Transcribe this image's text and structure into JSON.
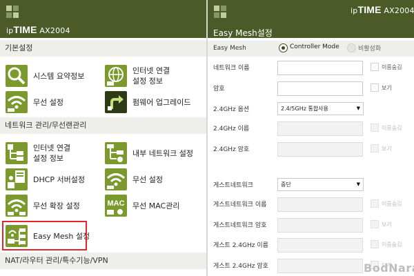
{
  "left": {
    "brand": {
      "prefix": "ip",
      "name": "TIME",
      "model": "AX2004"
    },
    "sections": {
      "basic": "기본설정",
      "network": "네트워크 관리/무선랜관리",
      "nat": "NAT/라우터 관리/특수기능/VPN"
    },
    "basic_items": [
      {
        "label": "시스템 요약정보",
        "icon": "magnifier-icon"
      },
      {
        "label": "인터넷 연결\n설정 정보",
        "icon": "globe-icon"
      },
      {
        "label": "무선 설정",
        "icon": "wifi-icon"
      },
      {
        "label": "펌웨어 업그레이드",
        "icon": "upgrade-arrow-icon"
      }
    ],
    "network_items": [
      {
        "label": "인터넷 연결\n설정 정보",
        "icon": "network-tree-icon"
      },
      {
        "label": "내부 네트워크 설정",
        "icon": "lan-tree-icon"
      },
      {
        "label": "DHCP 서버설정",
        "icon": "dhcp-icon"
      },
      {
        "label": "무선 설정",
        "icon": "wifi-icon"
      },
      {
        "label": "무선 확장 설정",
        "icon": "wifi-extend-icon"
      },
      {
        "label": "무선 MAC관리",
        "icon": "mac-icon",
        "badge": "MAC"
      },
      {
        "label": "Easy Mesh 설정",
        "icon": "easy-mesh-icon"
      }
    ]
  },
  "right": {
    "brand": {
      "prefix": "ip",
      "name": "TIME",
      "model": "AX2004"
    },
    "title": "Easy Mesh설정",
    "easy_mesh": {
      "label": "Easy Mesh",
      "options": [
        {
          "label": "Controller Mode",
          "selected": true
        },
        {
          "label": "비활성화",
          "selected": false
        }
      ]
    },
    "rows": [
      {
        "label": "네트워크 이름",
        "type": "input",
        "value": "",
        "check": "이름숨김",
        "disabled": false
      },
      {
        "label": "암호",
        "type": "input",
        "value": "",
        "check": "보기",
        "disabled": false
      },
      {
        "label": "2.4GHz 옵션",
        "type": "select",
        "value": "2.4/5GHz 통합사용",
        "check": "",
        "disabled": false
      },
      {
        "label": "2.4GHz 이름",
        "type": "input",
        "value": "",
        "check": "이름숨김",
        "disabled": true
      },
      {
        "label": "2.4GHz 암호",
        "type": "input",
        "value": "",
        "check": "보기",
        "disabled": true
      },
      {
        "label": "게스트네트워크",
        "type": "select",
        "value": "중단",
        "check": "",
        "disabled": false
      },
      {
        "label": "게스트네트워크 이름",
        "type": "input",
        "value": "",
        "check": "이름숨김",
        "disabled": true
      },
      {
        "label": "게스트네트워크 암호",
        "type": "input",
        "value": "",
        "check": "보기",
        "disabled": true
      },
      {
        "label": "게스트 2.4GHz 이름",
        "type": "input",
        "value": "",
        "check": "이름숨김",
        "disabled": true
      },
      {
        "label": "게스트 2.4GHz 암호",
        "type": "input",
        "value": "",
        "check": "보기",
        "disabled": true
      }
    ]
  },
  "watermark": "BodNara",
  "colors": {
    "header": "#4b5a26",
    "tile": "#7b9a2e",
    "highlight": "#e0262a",
    "section_bg": "#eeeeea"
  }
}
